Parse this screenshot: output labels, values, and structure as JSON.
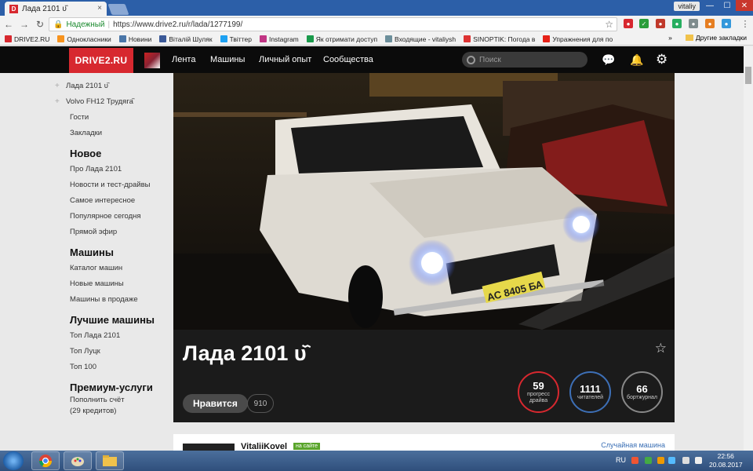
{
  "browser": {
    "tab_title": "Лада 2101 ᴜ᷈",
    "tab_close": "×",
    "user": "vitaliy",
    "min": "—",
    "max": "☐",
    "close": "✕",
    "back": "←",
    "forward": "→",
    "reload": "↻",
    "secure_label": "Надежный",
    "url": "https://www.drive2.ru/r/lada/1277199/",
    "star": "☆",
    "bookmarks": [
      {
        "label": "DRIVE2.RU",
        "color": "#d7282f"
      },
      {
        "label": "Однокласники",
        "color": "#f7931e"
      },
      {
        "label": "Новини",
        "color": "#4a76a8"
      },
      {
        "label": "Віталій Шуляк",
        "color": "#3b5998"
      },
      {
        "label": "Твіттер",
        "color": "#1da1f2"
      },
      {
        "label": "Instagram",
        "color": "#c13584"
      },
      {
        "label": "Як отримати доступ",
        "color": "#1a9a4b"
      },
      {
        "label": "Входящие - vitaliysh",
        "color": "#6c8f9b"
      },
      {
        "label": "SINOPTIK: Погода в",
        "color": "#d33"
      },
      {
        "label": "Упражнения для по",
        "color": "#e62117"
      }
    ],
    "bookmarks_more": "»",
    "other_bookmarks": "Другие закладки"
  },
  "site": {
    "logo": "DRIVE2.RU",
    "nav": [
      "Лента",
      "Машины",
      "Личный опыт",
      "Сообщества"
    ],
    "search_placeholder": "Поиск",
    "chat_icon": "💬",
    "bell_icon": "🔔",
    "gear_icon": "⚙"
  },
  "sidebar": {
    "cars": [
      {
        "plus": "+",
        "label": "Лада 2101 ᴜ᷈"
      },
      {
        "plus": "+",
        "label": "Volvo FH12 Трудяга᷈"
      }
    ],
    "misc": [
      "Гости",
      "Закладки"
    ],
    "sections": [
      {
        "title": "Новое",
        "items": [
          "Про Лада 2101",
          "Новости и тест-драйвы",
          "Самое интересное",
          "Популярное сегодня",
          "Прямой эфир"
        ]
      },
      {
        "title": "Машины",
        "items": [
          "Каталог машин",
          "Новые машины",
          "Машины в продаже"
        ]
      },
      {
        "title": "Лучшие машины",
        "items": [
          "Топ Лада 2101",
          "Топ Луцк",
          "Топ 100"
        ]
      }
    ],
    "premium": {
      "title": "Премиум-услуги",
      "line1": "Пополнить счёт",
      "line2": "(29 кредитов)"
    }
  },
  "car": {
    "title": "Лада 2101 ᴜ᷈",
    "plate": "АС 8405 БА",
    "like_label": "Нравится",
    "like_count": "910",
    "stats": [
      {
        "value": "59",
        "label": "прогресс драйва",
        "color": "#d7282f"
      },
      {
        "value": "1111",
        "label": "читателей",
        "color": "#3d6fb6"
      },
      {
        "value": "66",
        "label": "бортжурнал",
        "color": "#888888"
      }
    ]
  },
  "post": {
    "author": "VitaliiKovel",
    "badge": "на сайте",
    "random_link": "Случайная машина"
  },
  "taskbar": {
    "lang": "RU",
    "time": "22:56",
    "date": "20.08.2017"
  }
}
